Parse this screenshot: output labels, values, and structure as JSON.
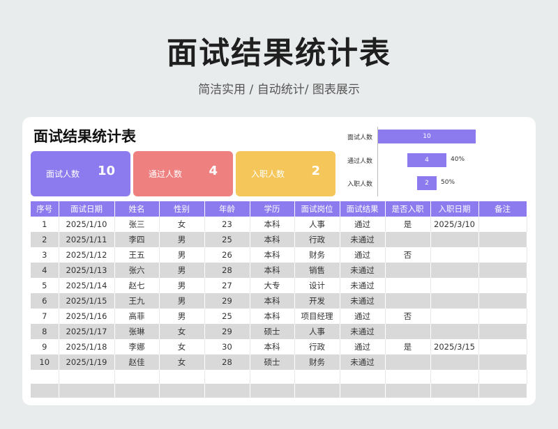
{
  "header": {
    "title": "面试结果统计表",
    "subtitle": "简洁实用 / 自动统计/ 图表展示"
  },
  "card": {
    "title": "面试结果统计表"
  },
  "stats": [
    {
      "label": "面试人数",
      "value": "10",
      "color": "#8b7bef"
    },
    {
      "label": "通过人数",
      "value": "4",
      "color": "#ef8080"
    },
    {
      "label": "入职人数",
      "value": "2",
      "color": "#f5c65a"
    }
  ],
  "chart_data": {
    "type": "bar",
    "orientation": "horizontal",
    "categories": [
      "面试人数",
      "通过人数",
      "入职人数"
    ],
    "values": [
      10,
      4,
      2
    ],
    "annotations": [
      "",
      "40%",
      "50%"
    ],
    "color": "#8b7bef"
  },
  "table": {
    "headers": [
      "序号",
      "面试日期",
      "姓名",
      "性别",
      "年龄",
      "学历",
      "面试岗位",
      "面试结果",
      "是否入职",
      "入职日期",
      "备注"
    ],
    "rows": [
      [
        "1",
        "2025/1/10",
        "张三",
        "女",
        "23",
        "本科",
        "人事",
        "通过",
        "是",
        "2025/3/10",
        ""
      ],
      [
        "2",
        "2025/1/11",
        "李四",
        "男",
        "25",
        "本科",
        "行政",
        "未通过",
        "",
        "",
        ""
      ],
      [
        "3",
        "2025/1/12",
        "王五",
        "男",
        "26",
        "本科",
        "财务",
        "通过",
        "否",
        "",
        ""
      ],
      [
        "4",
        "2025/1/13",
        "张六",
        "男",
        "28",
        "本科",
        "销售",
        "未通过",
        "",
        "",
        ""
      ],
      [
        "5",
        "2025/1/14",
        "赵七",
        "男",
        "27",
        "大专",
        "设计",
        "未通过",
        "",
        "",
        ""
      ],
      [
        "6",
        "2025/1/15",
        "王九",
        "男",
        "29",
        "本科",
        "开发",
        "未通过",
        "",
        "",
        ""
      ],
      [
        "7",
        "2025/1/16",
        "高菲",
        "男",
        "25",
        "本科",
        "项目经理",
        "通过",
        "否",
        "",
        ""
      ],
      [
        "8",
        "2025/1/17",
        "张琳",
        "女",
        "29",
        "硕士",
        "人事",
        "未通过",
        "",
        "",
        ""
      ],
      [
        "9",
        "2025/1/18",
        "李娜",
        "女",
        "30",
        "本科",
        "行政",
        "通过",
        "是",
        "2025/3/15",
        ""
      ],
      [
        "10",
        "2025/1/19",
        "赵佳",
        "女",
        "28",
        "硕士",
        "财务",
        "未通过",
        "",
        "",
        ""
      ],
      [
        "",
        "",
        "",
        "",
        "",
        "",
        "",
        "",
        "",
        "",
        ""
      ],
      [
        "",
        "",
        "",
        "",
        "",
        "",
        "",
        "",
        "",
        "",
        ""
      ]
    ]
  }
}
